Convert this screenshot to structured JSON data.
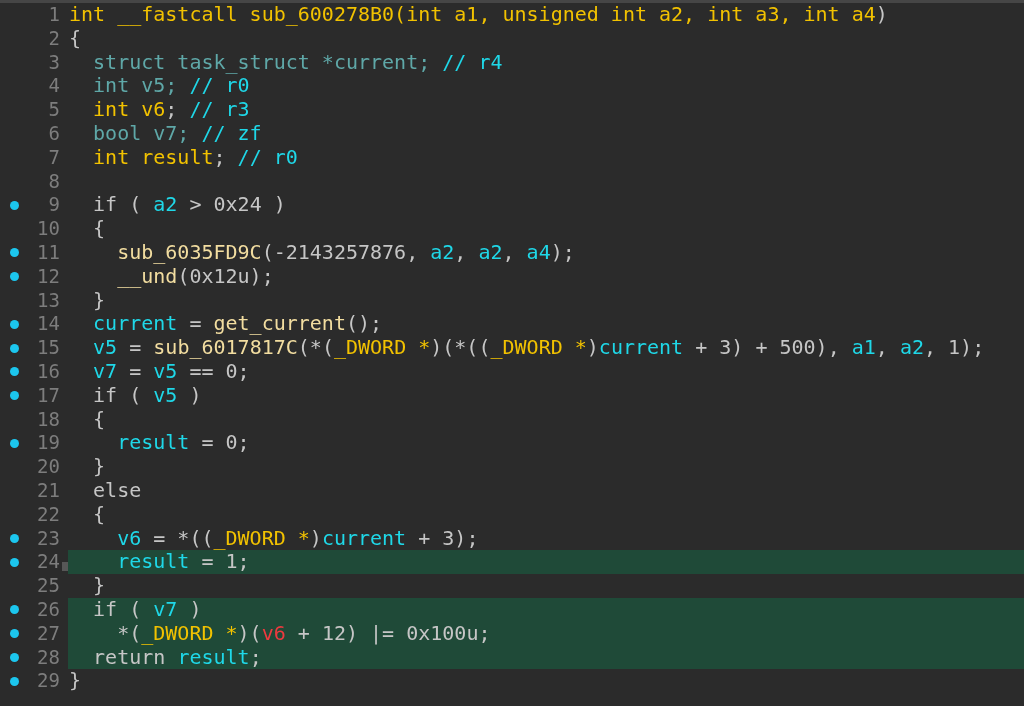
{
  "lines": [
    {
      "number": "1",
      "breakpoint": false,
      "highlighted": false,
      "cursor": false,
      "tokens": [
        {
          "kind": "type",
          "text": "int __fastcall sub_600278B0(int a1, unsigned int a2, int a3, int a4"
        },
        {
          "kind": "plain",
          "text": ")"
        }
      ]
    },
    {
      "number": "2",
      "breakpoint": false,
      "highlighted": false,
      "cursor": false,
      "tokens": [
        {
          "kind": "plain",
          "text": "{"
        }
      ]
    },
    {
      "number": "3",
      "breakpoint": false,
      "highlighted": false,
      "cursor": false,
      "tokens": [
        {
          "kind": "decl",
          "text": "  struct task_struct *current; "
        },
        {
          "kind": "var",
          "text": "// r4"
        }
      ]
    },
    {
      "number": "4",
      "breakpoint": false,
      "highlighted": false,
      "cursor": false,
      "tokens": [
        {
          "kind": "decl",
          "text": "  int v5; "
        },
        {
          "kind": "var",
          "text": "// r0"
        }
      ]
    },
    {
      "number": "5",
      "breakpoint": false,
      "highlighted": false,
      "cursor": false,
      "tokens": [
        {
          "kind": "type",
          "text": "  int v6"
        },
        {
          "kind": "plain",
          "text": "; "
        },
        {
          "kind": "var",
          "text": "// r3"
        }
      ]
    },
    {
      "number": "6",
      "breakpoint": false,
      "highlighted": false,
      "cursor": false,
      "tokens": [
        {
          "kind": "decl",
          "text": "  bool v7; "
        },
        {
          "kind": "var",
          "text": "// zf"
        }
      ]
    },
    {
      "number": "7",
      "breakpoint": false,
      "highlighted": false,
      "cursor": false,
      "tokens": [
        {
          "kind": "type",
          "text": "  int result"
        },
        {
          "kind": "plain",
          "text": "; "
        },
        {
          "kind": "var",
          "text": "// r0"
        }
      ]
    },
    {
      "number": "8",
      "breakpoint": false,
      "highlighted": false,
      "cursor": false
    },
    {
      "number": "9",
      "breakpoint": true,
      "highlighted": false,
      "cursor": false,
      "tokens": [
        {
          "kind": "plain",
          "text": "  if ( "
        },
        {
          "kind": "var",
          "text": "a2"
        },
        {
          "kind": "plain",
          "text": " > 0x24 )"
        }
      ]
    },
    {
      "number": "10",
      "breakpoint": false,
      "highlighted": false,
      "cursor": false,
      "tokens": [
        {
          "kind": "plain",
          "text": "  {"
        }
      ]
    },
    {
      "number": "11",
      "breakpoint": true,
      "highlighted": false,
      "cursor": false,
      "tokens": [
        {
          "kind": "func",
          "text": "    sub_6035FD9C"
        },
        {
          "kind": "plain",
          "text": "(-2143257876, "
        },
        {
          "kind": "var",
          "text": "a2"
        },
        {
          "kind": "plain",
          "text": ", "
        },
        {
          "kind": "var",
          "text": "a2"
        },
        {
          "kind": "plain",
          "text": ", "
        },
        {
          "kind": "var",
          "text": "a4"
        },
        {
          "kind": "plain",
          "text": ");"
        }
      ]
    },
    {
      "number": "12",
      "breakpoint": true,
      "highlighted": false,
      "cursor": false,
      "tokens": [
        {
          "kind": "func",
          "text": "    __und"
        },
        {
          "kind": "plain",
          "text": "(0x12u);"
        }
      ]
    },
    {
      "number": "13",
      "breakpoint": false,
      "highlighted": false,
      "cursor": false,
      "tokens": [
        {
          "kind": "plain",
          "text": "  }"
        }
      ]
    },
    {
      "number": "14",
      "breakpoint": true,
      "highlighted": false,
      "cursor": false,
      "tokens": [
        {
          "kind": "var",
          "text": "  current"
        },
        {
          "kind": "plain",
          "text": " = "
        },
        {
          "kind": "func",
          "text": "get_current"
        },
        {
          "kind": "plain",
          "text": "();"
        }
      ]
    },
    {
      "number": "15",
      "breakpoint": true,
      "highlighted": false,
      "cursor": false,
      "tokens": [
        {
          "kind": "var",
          "text": "  v5"
        },
        {
          "kind": "plain",
          "text": " = "
        },
        {
          "kind": "func",
          "text": "sub_6017817C"
        },
        {
          "kind": "plain",
          "text": "(*("
        },
        {
          "kind": "type",
          "text": "_DWORD *"
        },
        {
          "kind": "plain",
          "text": ")(*(("
        },
        {
          "kind": "type",
          "text": "_DWORD *"
        },
        {
          "kind": "plain",
          "text": ")"
        },
        {
          "kind": "var",
          "text": "current"
        },
        {
          "kind": "plain",
          "text": " + 3) + 500), "
        },
        {
          "kind": "var",
          "text": "a1"
        },
        {
          "kind": "plain",
          "text": ", "
        },
        {
          "kind": "var",
          "text": "a2"
        },
        {
          "kind": "plain",
          "text": ", 1);"
        }
      ]
    },
    {
      "number": "16",
      "breakpoint": true,
      "highlighted": false,
      "cursor": false,
      "tokens": [
        {
          "kind": "var",
          "text": "  v7"
        },
        {
          "kind": "plain",
          "text": " = "
        },
        {
          "kind": "var",
          "text": "v5"
        },
        {
          "kind": "plain",
          "text": " == 0;"
        }
      ]
    },
    {
      "number": "17",
      "breakpoint": true,
      "highlighted": false,
      "cursor": false,
      "tokens": [
        {
          "kind": "plain",
          "text": "  if ( "
        },
        {
          "kind": "var",
          "text": "v5"
        },
        {
          "kind": "plain",
          "text": " )"
        }
      ]
    },
    {
      "number": "18",
      "breakpoint": false,
      "highlighted": false,
      "cursor": false,
      "tokens": [
        {
          "kind": "plain",
          "text": "  {"
        }
      ]
    },
    {
      "number": "19",
      "breakpoint": true,
      "highlighted": false,
      "cursor": false,
      "tokens": [
        {
          "kind": "var",
          "text": "    result"
        },
        {
          "kind": "plain",
          "text": " = 0;"
        }
      ]
    },
    {
      "number": "20",
      "breakpoint": false,
      "highlighted": false,
      "cursor": false,
      "tokens": [
        {
          "kind": "plain",
          "text": "  }"
        }
      ]
    },
    {
      "number": "21",
      "breakpoint": false,
      "highlighted": false,
      "cursor": false,
      "tokens": [
        {
          "kind": "plain",
          "text": "  else"
        }
      ]
    },
    {
      "number": "22",
      "breakpoint": false,
      "highlighted": false,
      "cursor": false,
      "tokens": [
        {
          "kind": "plain",
          "text": "  {"
        }
      ]
    },
    {
      "number": "23",
      "breakpoint": true,
      "highlighted": false,
      "cursor": false,
      "tokens": [
        {
          "kind": "var",
          "text": "    v6"
        },
        {
          "kind": "plain",
          "text": " = *(("
        },
        {
          "kind": "type",
          "text": "_DWORD *"
        },
        {
          "kind": "plain",
          "text": ")"
        },
        {
          "kind": "var",
          "text": "current"
        },
        {
          "kind": "plain",
          "text": " + 3);"
        }
      ]
    },
    {
      "number": "24",
      "breakpoint": true,
      "highlighted": true,
      "cursor": true,
      "tokens": [
        {
          "kind": "var",
          "text": "    result"
        },
        {
          "kind": "plain",
          "text": " = 1;"
        }
      ]
    },
    {
      "number": "25",
      "breakpoint": false,
      "highlighted": false,
      "cursor": false,
      "tokens": [
        {
          "kind": "plain",
          "text": "  }"
        }
      ]
    },
    {
      "number": "26",
      "breakpoint": true,
      "highlighted": true,
      "cursor": false,
      "tokens": [
        {
          "kind": "plain",
          "text": "  if ( "
        },
        {
          "kind": "var",
          "text": "v7"
        },
        {
          "kind": "plain",
          "text": " )"
        }
      ]
    },
    {
      "number": "27",
      "breakpoint": true,
      "highlighted": true,
      "cursor": false,
      "tokens": [
        {
          "kind": "plain",
          "text": "    *("
        },
        {
          "kind": "type",
          "text": "_DWORD *"
        },
        {
          "kind": "plain",
          "text": ")("
        },
        {
          "kind": "error",
          "text": "v6"
        },
        {
          "kind": "plain",
          "text": " + 12) |= 0x100u;"
        }
      ]
    },
    {
      "number": "28",
      "breakpoint": true,
      "highlighted": true,
      "cursor": false,
      "tokens": [
        {
          "kind": "plain",
          "text": "  return "
        },
        {
          "kind": "var",
          "text": "result"
        },
        {
          "kind": "plain",
          "text": ";"
        }
      ]
    },
    {
      "number": "29",
      "breakpoint": true,
      "highlighted": false,
      "cursor": false,
      "tokens": [
        {
          "kind": "plain",
          "text": "}"
        }
      ]
    }
  ]
}
